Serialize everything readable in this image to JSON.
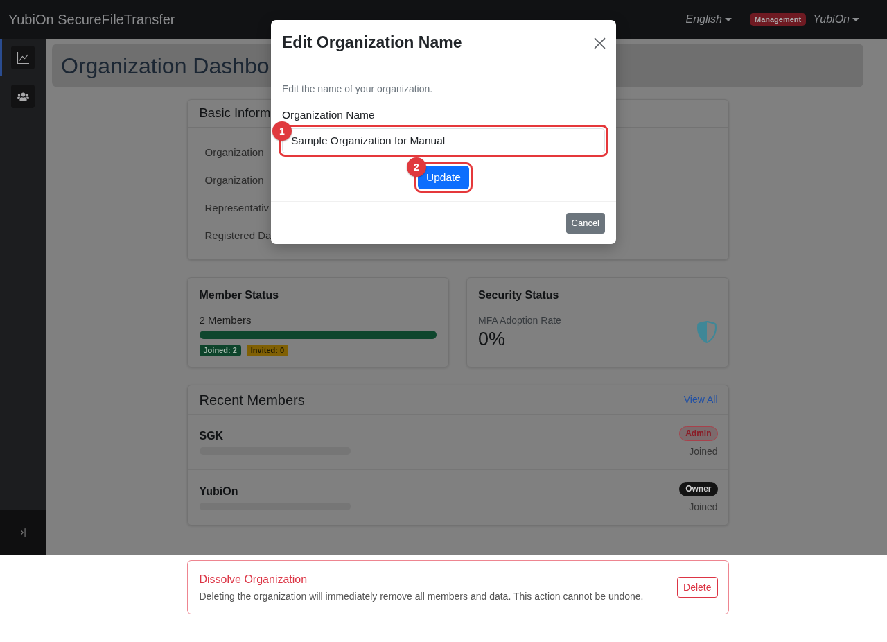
{
  "navbar": {
    "brand": "YubiOn SecureFileTransfer",
    "language": "English",
    "role_badge": "Management",
    "user": "YubiOn"
  },
  "sidebar": {
    "items": [
      {
        "selected": true
      },
      {
        "selected": false
      }
    ]
  },
  "page_title": "Organization Dashbo",
  "basic_information": {
    "title": "Basic Inform",
    "rows": [
      "Organization",
      "Organization",
      "Representativ",
      "Registered Da"
    ]
  },
  "member_status": {
    "title": "Member Status",
    "count": "2 Members",
    "level": 1,
    "badges": [
      {
        "label": "Joined: 2",
        "color": "#0d442b"
      },
      {
        "label": "Invited: 0",
        "color": "#806004"
      }
    ]
  },
  "security_status": {
    "title": "Security Status",
    "metric_label": "MFA Adoption Rate",
    "metric_value": "0%"
  },
  "recent_members": {
    "title": "Recent Members",
    "link": "View All",
    "members": [
      {
        "name": "SGK",
        "role": {
          "text": "Admin",
          "kind": "outlined"
        },
        "status": "Joined"
      },
      {
        "name": "YubiOn",
        "role": {
          "text": "Owner",
          "kind": "filled"
        },
        "status": "Joined"
      }
    ]
  },
  "danger_zone": {
    "title": "Dissolve Organization",
    "description": "Deleting the organization will immediately remove all members and data. This action cannot be undone.",
    "button": "Delete"
  },
  "modal": {
    "title": "Edit Organization Name",
    "description": "Edit the name of your organization.",
    "field": {
      "label": "Organization Name",
      "value": "Sample Organization for Manual",
      "callout": "1"
    },
    "submit": {
      "label": "Update",
      "callout": "2"
    },
    "cancel": "Cancel"
  }
}
